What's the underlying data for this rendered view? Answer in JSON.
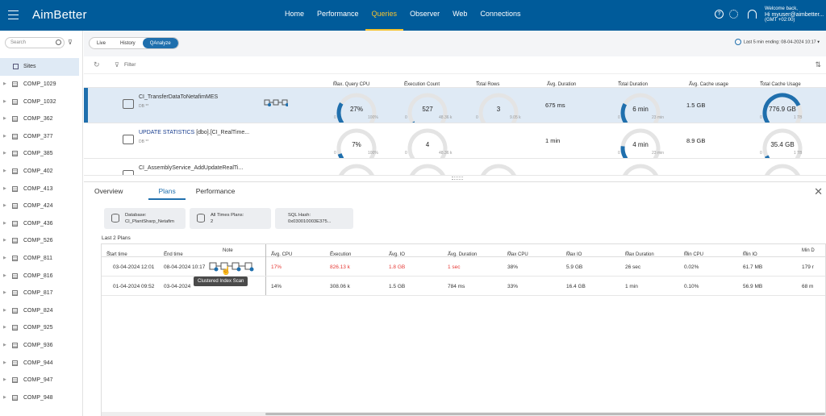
{
  "header": {
    "logo": "AimBetter",
    "nav": [
      {
        "label": "Home",
        "active": false
      },
      {
        "label": "Performance",
        "active": false
      },
      {
        "label": "Queries",
        "active": true
      },
      {
        "label": "Observer",
        "active": false
      },
      {
        "label": "Web",
        "active": false
      },
      {
        "label": "Connections",
        "active": false
      }
    ],
    "user": {
      "welcome": "Welcome back,",
      "name": "Hi myuser@aimbetter...",
      "tz": "(GMT +02:00)"
    },
    "colors": {
      "bar": "#005b9a",
      "active_nav": "#f5c330"
    }
  },
  "sidebar": {
    "search_placeholder": "Search",
    "root": "Sites",
    "items": [
      "COMP_1029",
      "COMP_1032",
      "COMP_362",
      "COMP_377",
      "COMP_385",
      "COMP_402",
      "COMP_413",
      "COMP_424",
      "COMP_436",
      "COMP_526",
      "COMP_811",
      "COMP_816",
      "COMP_817",
      "COMP_824",
      "COMP_925",
      "COMP_936",
      "COMP_944",
      "COMP_947",
      "COMP_948"
    ]
  },
  "modebar": {
    "modes": [
      {
        "label": "Live",
        "active": false
      },
      {
        "label": "History",
        "active": false
      },
      {
        "label": "QAnalyze",
        "active": true
      }
    ],
    "time_range": "Last 5 min ending: 08-04-2024 10:17"
  },
  "filterbar": {
    "filter_label": "Filter"
  },
  "query_columns": [
    "Max. Query CPU",
    "Execution Count",
    "Total Rows",
    "Avg. Duration",
    "Total Duration",
    "Avg. Cache usage",
    "Total Cache Usage"
  ],
  "queries": [
    {
      "name": "CI_TransferDataToNetafimMES",
      "prefix": "",
      "db": "DB **",
      "cpu": {
        "value": "27%",
        "min": "0",
        "max": "100%",
        "frac": 0.27
      },
      "exec": {
        "value": "527",
        "min": "0",
        "max": "48.36 k",
        "frac": 0.01
      },
      "rows": {
        "value": "3",
        "min": "0",
        "max": "9.05 k",
        "frac": 0.0
      },
      "avg_duration": "675 ms",
      "total_duration": {
        "value": "6 min",
        "min": "0",
        "max": "23 min",
        "frac": 0.26
      },
      "avg_cache": "1.5 GB",
      "total_cache": {
        "value": "776.9 GB",
        "min": "0",
        "max": "1 TB",
        "frac": 0.76
      }
    },
    {
      "name": "[dbo].[CI_RealTime...",
      "prefix": "UPDATE STATISTICS",
      "db": "DB **",
      "cpu": {
        "value": "7%",
        "min": "0",
        "max": "100%",
        "frac": 0.07
      },
      "exec": {
        "value": "4",
        "min": "0",
        "max": "48.36 k",
        "frac": 0.0
      },
      "rows": {
        "value": "",
        "min": "",
        "max": "",
        "frac": 0
      },
      "avg_duration": "1 min",
      "total_duration": {
        "value": "4 min",
        "min": "0",
        "max": "23 min",
        "frac": 0.17
      },
      "avg_cache": "8.9 GB",
      "total_cache": {
        "value": "35.4 GB",
        "min": "0",
        "max": "1 TB",
        "frac": 0.04
      }
    },
    {
      "name": "CI_AssemblyService_AddUpdateRealTi...",
      "prefix": "",
      "db": "",
      "cpu": {
        "value": "",
        "min": "",
        "max": "",
        "frac": 0
      },
      "exec": {
        "value": "",
        "min": "",
        "max": "",
        "frac": 0
      },
      "rows": {
        "value": "",
        "min": "",
        "max": "",
        "frac": 0
      },
      "avg_duration": "",
      "total_duration": {
        "value": "",
        "min": "",
        "max": "",
        "frac": 0
      },
      "avg_cache": "",
      "total_cache": {
        "value": "",
        "min": "",
        "max": "",
        "frac": 0
      }
    }
  ],
  "detail": {
    "tabs": [
      {
        "label": "Overview",
        "active": false
      },
      {
        "label": "Plans",
        "active": true
      },
      {
        "label": "Performance",
        "active": false
      }
    ],
    "cards": [
      {
        "title": "Database:",
        "value": "CI_PlantSharp_Netafim"
      },
      {
        "title": "All Times Plans:",
        "value": "2"
      },
      {
        "title": "SQL Hash:",
        "value": "0x030010003E375..."
      }
    ],
    "plans_label": "Last 2 Plans",
    "plan_columns": [
      "Start time",
      "End time",
      "Note",
      "Avg. CPU",
      "Execution",
      "Avg. IO",
      "Avg. Duration",
      "Max CPU",
      "Max IO",
      "Max Duration",
      "Min CPU",
      "Min IO",
      "Min D"
    ],
    "plans": [
      {
        "start": "03-04-2024 12:01",
        "end": "08-04-2024 10:17",
        "avg_cpu": "17%",
        "execution": "826.13 k",
        "avg_io": "1.8 GB",
        "avg_duration": "1 sec",
        "max_cpu": "38%",
        "max_io": "5.9 GB",
        "max_duration": "26 sec",
        "min_cpu": "0.02%",
        "min_io": "61.7 MB",
        "min_d": "179 r"
      },
      {
        "start": "01-04-2024 09:52",
        "end": "03-04-2024",
        "avg_cpu": "14%",
        "execution": "308.06 k",
        "avg_io": "1.5 GB",
        "avg_duration": "784 ms",
        "max_cpu": "33%",
        "max_io": "16.4 GB",
        "max_duration": "1 min",
        "min_cpu": "0.10%",
        "min_io": "56.9 MB",
        "min_d": "68 m"
      }
    ],
    "tooltip": "Clustered Index Scan"
  }
}
